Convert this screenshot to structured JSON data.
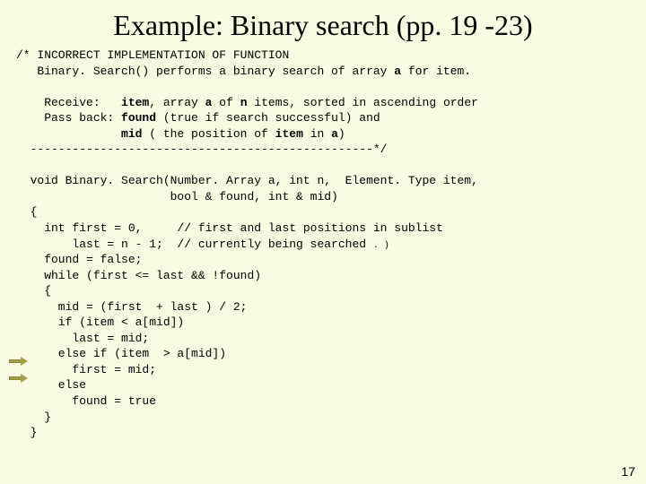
{
  "title": "Example:  Binary search (pp. 19 -23)",
  "c": {
    "l1a": "/* INCORRECT IMPLEMENTATION OF FUNCTION",
    "l2a": "   Binary. Search() performs a binary search of array ",
    "l2b": "a",
    "l2c": " for item.",
    "l3a": "    Receive:   ",
    "l3b": "item",
    "l3c": ", array ",
    "l3d": "a",
    "l3e": " of ",
    "l3f": "n",
    "l3g": " items, sorted in ascending order",
    "l4a": "    Pass back: ",
    "l4b": "found",
    "l4c": " (true if search successful) and",
    "l5a": "               ",
    "l5b": "mid",
    "l5c": " ( the position of ",
    "l5d": "item",
    "l5e": " in ",
    "l5f": "a",
    "l5g": ")",
    "l6": "  -------------------------------------------------*/",
    "l7": "  void Binary. Search(Number. Array a, int n,  Element. Type item,",
    "l8": "                      bool & found, int & mid)",
    "l9": "  {",
    "l10": "    int first = 0,     // first and last positions in sublist",
    "l11a": "        last = n - 1;  // currently being searched ",
    "l11b": ". )",
    "l12": "    found = false;",
    "l13": "    while (first <= last && !found)",
    "l14": "    {",
    "l15": "      mid = (first  + last ) / 2;",
    "l16": "      if (item < a[mid])",
    "l17": "        last = mid;",
    "l18": "      else if (item  > a[mid])",
    "l19": "        first = mid;",
    "l20": "      else",
    "l21": "        found = true",
    "l22": "    }",
    "l23": "  }"
  },
  "pagenum": "17"
}
